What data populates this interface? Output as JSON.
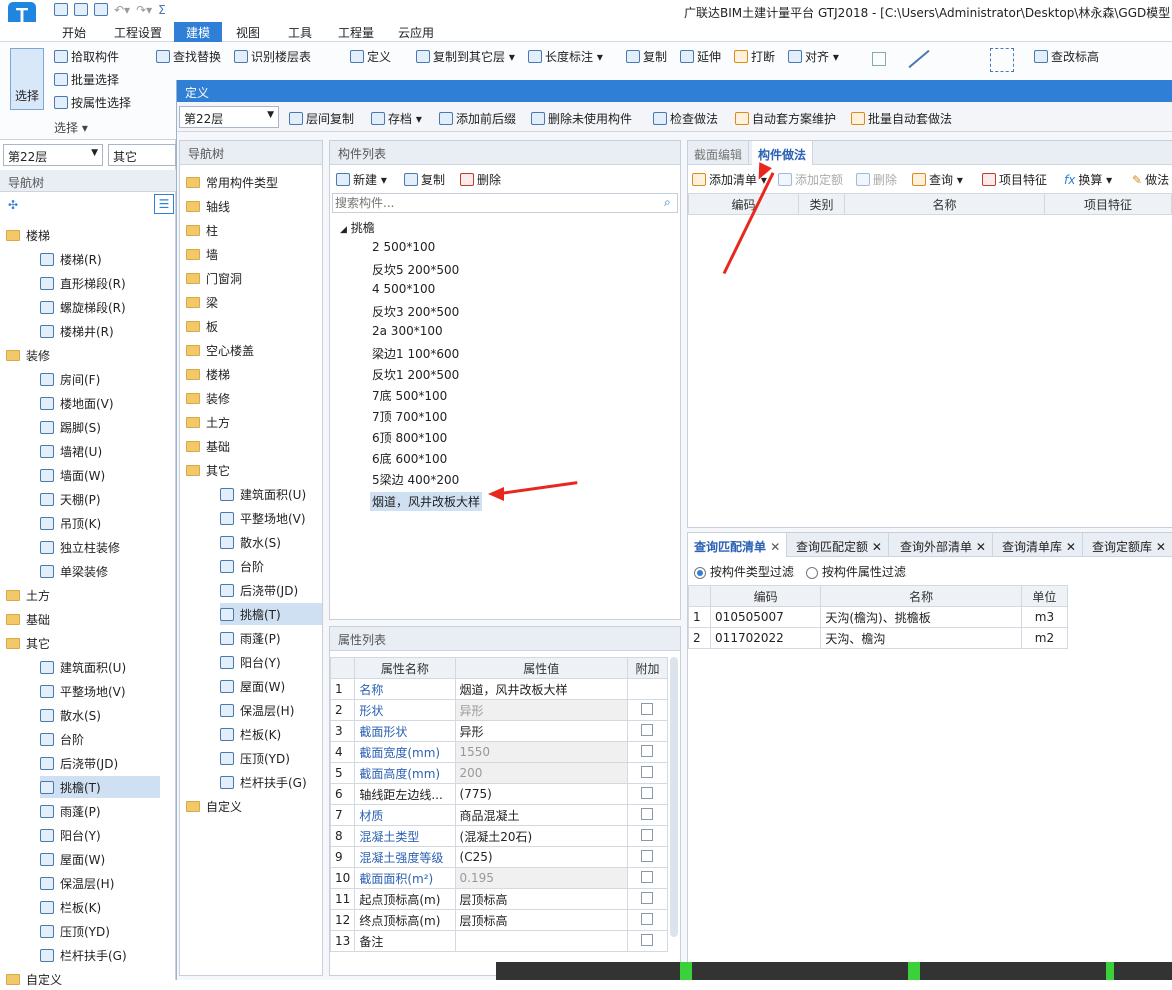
{
  "title": "广联达BIM土建计量平台 GTJ2018 - [C:\\Users\\Administrator\\Desktop\\林永森\\GGD模型",
  "menu": [
    "开始",
    "工程设置",
    "建模",
    "视图",
    "工具",
    "工程量",
    "云应用"
  ],
  "ribbon": {
    "pick": "拾取构件",
    "batch": "批量选择",
    "by_prop": "按属性选择",
    "select": "选择",
    "select_group": "选择 ▾",
    "find_replace": "查找替换",
    "recognize_floor": "识别楼层表",
    "define": "定义",
    "copy_other": "复制到其它层 ▾",
    "len_mark": "长度标注 ▾",
    "copy": "复制",
    "extend": "延伸",
    "break": "打断",
    "align": "对齐 ▾",
    "check_elev": "查改标高"
  },
  "left": {
    "floor": "第22层",
    "other": "其它",
    "nav_title": "导航树",
    "items": [
      {
        "t": "楼梯",
        "lvl": 0
      },
      {
        "t": "楼梯(R)",
        "lvl": 1
      },
      {
        "t": "直形梯段(R)",
        "lvl": 1
      },
      {
        "t": "螺旋梯段(R)",
        "lvl": 1
      },
      {
        "t": "楼梯井(R)",
        "lvl": 1
      },
      {
        "t": "装修",
        "lvl": 0
      },
      {
        "t": "房间(F)",
        "lvl": 1
      },
      {
        "t": "楼地面(V)",
        "lvl": 1
      },
      {
        "t": "踢脚(S)",
        "lvl": 1
      },
      {
        "t": "墙裙(U)",
        "lvl": 1
      },
      {
        "t": "墙面(W)",
        "lvl": 1
      },
      {
        "t": "天棚(P)",
        "lvl": 1
      },
      {
        "t": "吊顶(K)",
        "lvl": 1
      },
      {
        "t": "独立柱装修",
        "lvl": 1
      },
      {
        "t": "单梁装修",
        "lvl": 1
      },
      {
        "t": "土方",
        "lvl": 0
      },
      {
        "t": "基础",
        "lvl": 0
      },
      {
        "t": "其它",
        "lvl": 0
      },
      {
        "t": "建筑面积(U)",
        "lvl": 1
      },
      {
        "t": "平整场地(V)",
        "lvl": 1
      },
      {
        "t": "散水(S)",
        "lvl": 1
      },
      {
        "t": "台阶",
        "lvl": 1
      },
      {
        "t": "后浇带(JD)",
        "lvl": 1
      },
      {
        "t": "挑檐(T)",
        "lvl": 1,
        "hl": true
      },
      {
        "t": "雨蓬(P)",
        "lvl": 1
      },
      {
        "t": "阳台(Y)",
        "lvl": 1
      },
      {
        "t": "屋面(W)",
        "lvl": 1
      },
      {
        "t": "保温层(H)",
        "lvl": 1
      },
      {
        "t": "栏板(K)",
        "lvl": 1
      },
      {
        "t": "压顶(YD)",
        "lvl": 1
      },
      {
        "t": "栏杆扶手(G)",
        "lvl": 1
      },
      {
        "t": "自定义",
        "lvl": 0
      }
    ]
  },
  "dialog": {
    "title": "定义",
    "floor": "第22层",
    "toolbar": [
      "层间复制",
      "存档 ▾",
      "添加前后缀",
      "删除未使用构件",
      "检查做法",
      "自动套方案维护",
      "批量自动套做法"
    ],
    "nav_title": "导航树",
    "nav": [
      {
        "t": "常用构件类型",
        "lvl": 0
      },
      {
        "t": "轴线",
        "lvl": 0
      },
      {
        "t": "柱",
        "lvl": 0
      },
      {
        "t": "墙",
        "lvl": 0
      },
      {
        "t": "门窗洞",
        "lvl": 0
      },
      {
        "t": "梁",
        "lvl": 0
      },
      {
        "t": "板",
        "lvl": 0
      },
      {
        "t": "空心楼盖",
        "lvl": 0
      },
      {
        "t": "楼梯",
        "lvl": 0
      },
      {
        "t": "装修",
        "lvl": 0
      },
      {
        "t": "土方",
        "lvl": 0
      },
      {
        "t": "基础",
        "lvl": 0
      },
      {
        "t": "其它",
        "lvl": 0
      },
      {
        "t": "建筑面积(U)",
        "lvl": 1
      },
      {
        "t": "平整场地(V)",
        "lvl": 1
      },
      {
        "t": "散水(S)",
        "lvl": 1
      },
      {
        "t": "台阶",
        "lvl": 1
      },
      {
        "t": "后浇带(JD)",
        "lvl": 1
      },
      {
        "t": "挑檐(T)",
        "lvl": 1,
        "hl": true
      },
      {
        "t": "雨蓬(P)",
        "lvl": 1
      },
      {
        "t": "阳台(Y)",
        "lvl": 1
      },
      {
        "t": "屋面(W)",
        "lvl": 1
      },
      {
        "t": "保温层(H)",
        "lvl": 1
      },
      {
        "t": "栏板(K)",
        "lvl": 1
      },
      {
        "t": "压顶(YD)",
        "lvl": 1
      },
      {
        "t": "栏杆扶手(G)",
        "lvl": 1
      },
      {
        "t": "自定义",
        "lvl": 0
      }
    ],
    "comp_title": "构件列表",
    "comp_tools": [
      "新建 ▾",
      "复制",
      "删除"
    ],
    "search_ph": "搜索构件...",
    "comp_group": "挑檐",
    "comps": [
      "2  500*100",
      "反坎5  200*500",
      "4  500*100",
      "反坎3  200*500",
      "2a  300*100",
      "梁边1  100*600",
      "反坎1  200*500",
      "7底  500*100",
      "7顶  700*100",
      "6顶  800*100",
      "6底  600*100",
      "5梁边  400*200",
      "烟道，风井改板大样"
    ],
    "prop_title": "属性列表",
    "prop_cols": [
      "属性名称",
      "属性值",
      "附加"
    ],
    "props": [
      {
        "n": "1",
        "k": "名称",
        "v": "烟道，风井改板大样",
        "blue": true,
        "gray": false,
        "chk": false
      },
      {
        "n": "2",
        "k": "形状",
        "v": "异形",
        "blue": true,
        "gray": true,
        "chk": true
      },
      {
        "n": "3",
        "k": "截面形状",
        "v": "异形",
        "blue": true,
        "gray": false,
        "chk": true
      },
      {
        "n": "4",
        "k": "截面宽度(mm)",
        "v": "1550",
        "blue": true,
        "gray": true,
        "chk": true
      },
      {
        "n": "5",
        "k": "截面高度(mm)",
        "v": "200",
        "blue": true,
        "gray": true,
        "chk": true
      },
      {
        "n": "6",
        "k": "轴线距左边线...",
        "v": "(775)",
        "blue": false,
        "gray": false,
        "chk": true
      },
      {
        "n": "7",
        "k": "材质",
        "v": "商品混凝土",
        "blue": true,
        "gray": false,
        "chk": true
      },
      {
        "n": "8",
        "k": "混凝土类型",
        "v": "(混凝土20石)",
        "blue": true,
        "gray": false,
        "chk": true
      },
      {
        "n": "9",
        "k": "混凝土强度等级",
        "v": "(C25)",
        "blue": true,
        "gray": false,
        "chk": true
      },
      {
        "n": "10",
        "k": "截面面积(m²)",
        "v": "0.195",
        "blue": true,
        "gray": true,
        "chk": true
      },
      {
        "n": "11",
        "k": "起点顶标高(m)",
        "v": "层顶标高",
        "blue": false,
        "gray": false,
        "chk": true
      },
      {
        "n": "12",
        "k": "终点顶标高(m)",
        "v": "层顶标高",
        "blue": false,
        "gray": false,
        "chk": true
      },
      {
        "n": "13",
        "k": "备注",
        "v": "",
        "blue": false,
        "gray": false,
        "chk": true
      }
    ],
    "tabs_top": [
      "截面编辑",
      "构件做法"
    ],
    "method_tools": [
      "添加清单 ▾",
      "添加定额",
      "删除",
      "查询 ▾",
      "项目特征",
      "换算 ▾",
      "做法"
    ],
    "method_cols": [
      "编码",
      "类别",
      "名称",
      "项目特征"
    ],
    "tabs_bottom": [
      "查询匹配清单",
      "查询匹配定额",
      "查询外部清单",
      "查询清单库",
      "查询定额库"
    ],
    "filter1": "按构件类型过滤",
    "filter2": "按构件属性过滤",
    "match_cols": [
      "编码",
      "名称",
      "单位"
    ],
    "match_rows": [
      {
        "n": "1",
        "code": "010505007",
        "name": "天沟(檐沟)、挑檐板",
        "unit": "m3"
      },
      {
        "n": "2",
        "code": "011702022",
        "name": "天沟、檐沟",
        "unit": "m2"
      }
    ]
  }
}
